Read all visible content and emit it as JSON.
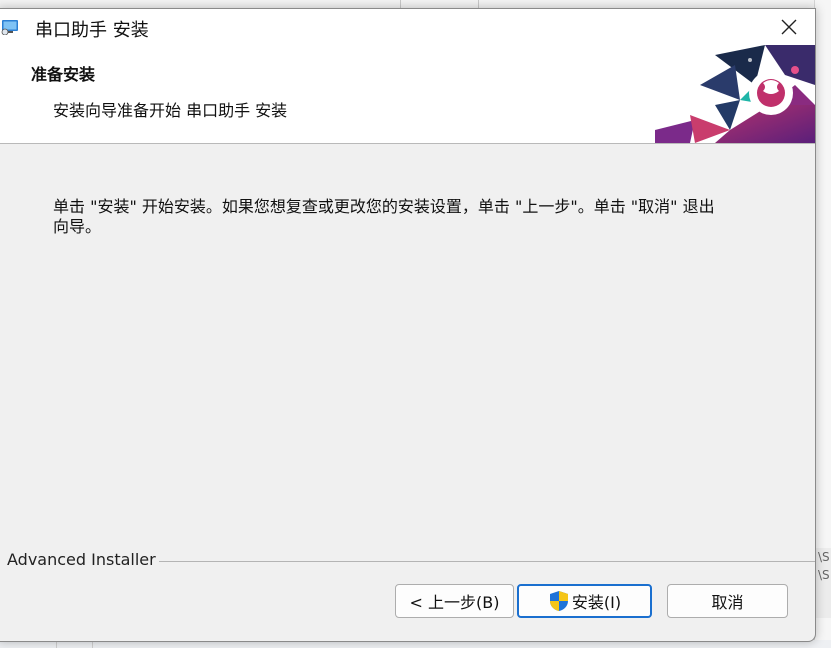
{
  "window": {
    "title": "串口助手 安装",
    "close_label": "✕"
  },
  "banner": {
    "title": "准备安装",
    "subtitle": "安装向导准备开始 串口助手 安装"
  },
  "body": {
    "line1": "单击 \"安装\" 开始安装。如果您想复查或更改您的安装设置，单击 \"上一步\"。单击 \"取消\" 退出",
    "line2": "向导。"
  },
  "footer": {
    "brand": "Advanced Installer"
  },
  "buttons": {
    "back": "< 上一步(B)",
    "install": "安装(I)",
    "cancel": "取消"
  },
  "background": {
    "right_glyphs": [
      "\\S",
      "\\S"
    ]
  },
  "colors": {
    "install_border": "#1a6fcf",
    "shield_blue": "#1e73d8",
    "shield_yellow": "#f5c518",
    "art_purple": "#7b2a8a",
    "art_teal": "#1fb5a8"
  }
}
